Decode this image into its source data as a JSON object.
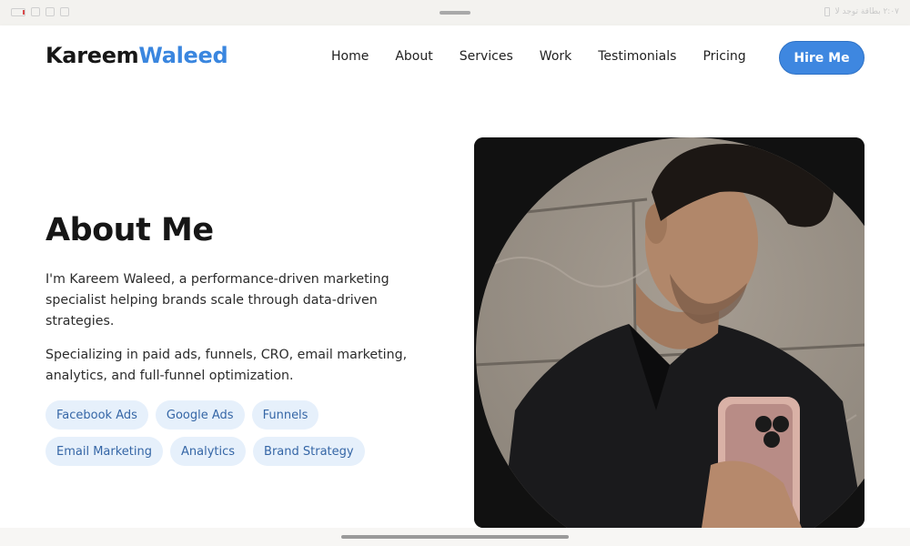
{
  "status_bar": {
    "right_text": "٢:٠٧ بطاقة توجد لا"
  },
  "nav": {
    "logo_first": "Kareem",
    "logo_last": "Waleed",
    "links": [
      "Home",
      "About",
      "Services",
      "Work",
      "Testimonials",
      "Pricing"
    ],
    "cta_label": "Hire Me"
  },
  "about": {
    "title": "About Me",
    "paragraph1": "I'm Kareem Waleed, a performance-driven marketing specialist helping brands scale through data-driven strategies.",
    "paragraph2": "Specializing in paid ads, funnels, CRO, email marketing, analytics, and full-funnel optimization.",
    "tags": [
      "Facebook Ads",
      "Google Ads",
      "Funnels",
      "Email Marketing",
      "Analytics",
      "Brand Strategy"
    ]
  },
  "colors": {
    "accent": "#3e87e0",
    "tag_bg": "#e6f0fb",
    "tag_text": "#3566a6"
  }
}
